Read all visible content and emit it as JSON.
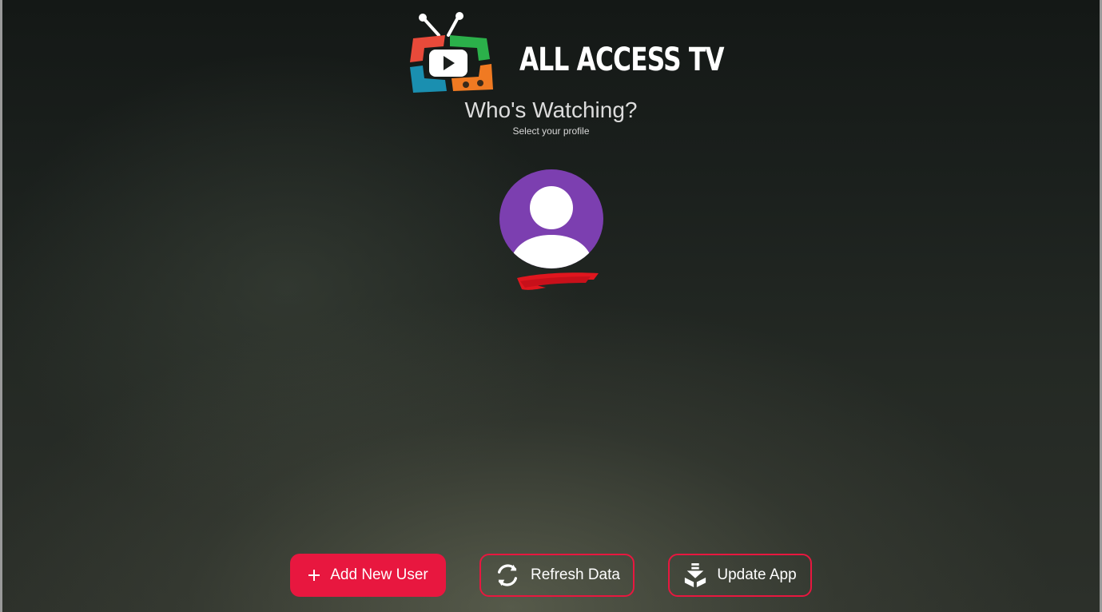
{
  "app": {
    "title": "ALL ACCESS TV"
  },
  "screen": {
    "heading": "Who's Watching?",
    "subheading": "Select your profile"
  },
  "profiles": [
    {
      "name": "",
      "avatar_color": "#7c3fb0",
      "redacted": true
    }
  ],
  "actions": {
    "add_user_label": "Add New User",
    "refresh_label": "Refresh Data",
    "update_label": "Update App"
  },
  "colors": {
    "accent": "#e8173f",
    "avatar": "#7c3fb0",
    "logo_red": "#e84a3a",
    "logo_green": "#2bb04a",
    "logo_blue": "#1a8fb0",
    "logo_orange": "#f07a22"
  },
  "icons": {
    "add": "plus-icon",
    "refresh": "refresh-icon",
    "update": "download-icon",
    "avatar": "user-silhouette-icon",
    "logo": "tv-logo-icon"
  }
}
